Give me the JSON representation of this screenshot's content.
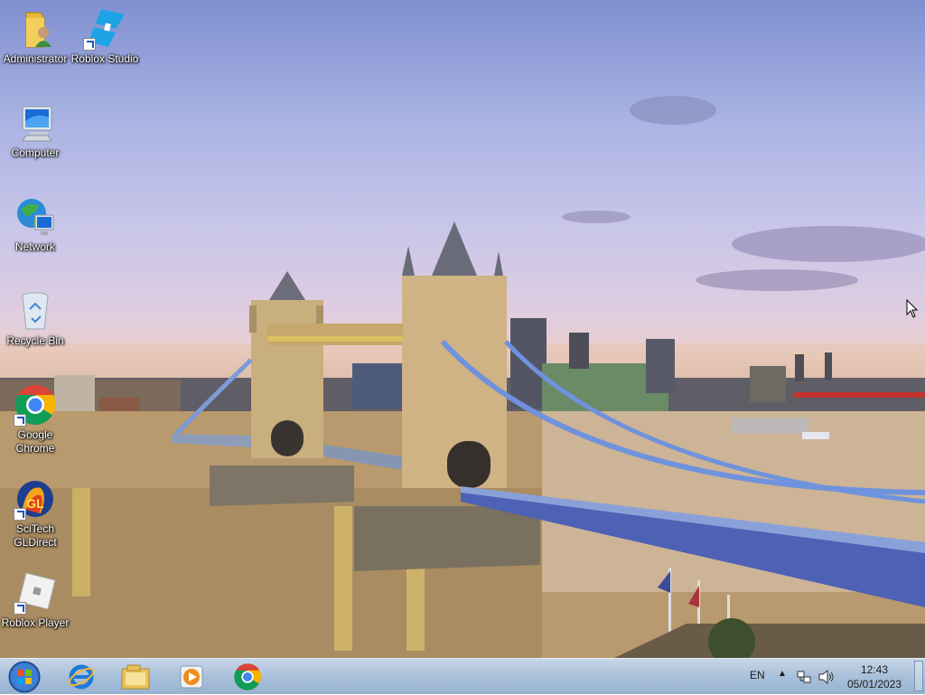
{
  "desktop": {
    "wallpaper": "Tower Bridge, London at sunset",
    "icons": [
      {
        "label": "Administrator",
        "icon": "user-folder-icon"
      },
      {
        "label": "Roblox Studio",
        "icon": "roblox-studio-icon"
      },
      {
        "label": "Computer",
        "icon": "computer-icon"
      },
      {
        "label": "Network",
        "icon": "network-icon"
      },
      {
        "label": "Recycle Bin",
        "icon": "recycle-bin-icon"
      },
      {
        "label": "Google\nChrome",
        "icon": "chrome-icon"
      },
      {
        "label": "SciTech\nGLDirect",
        "icon": "scitech-gldirect-icon"
      },
      {
        "label": "Roblox Player",
        "icon": "roblox-player-icon"
      }
    ]
  },
  "taskbar": {
    "start": "start-orb-icon",
    "pinned": [
      {
        "name": "Internet Explorer",
        "icon": "internet-explorer-icon"
      },
      {
        "name": "Windows Explorer",
        "icon": "file-explorer-icon"
      },
      {
        "name": "Windows Media Player",
        "icon": "media-player-icon"
      },
      {
        "name": "Google Chrome",
        "icon": "chrome-icon"
      }
    ],
    "tray": {
      "language": "EN",
      "time": "12:43",
      "date": "05/01/2023"
    }
  },
  "colors": {
    "taskbar": "#a9c0da",
    "label_text": "#ffffff",
    "chrome_red": "#db4437",
    "chrome_yellow": "#f4b400",
    "chrome_green": "#0f9d58",
    "chrome_blue": "#4285f4"
  }
}
